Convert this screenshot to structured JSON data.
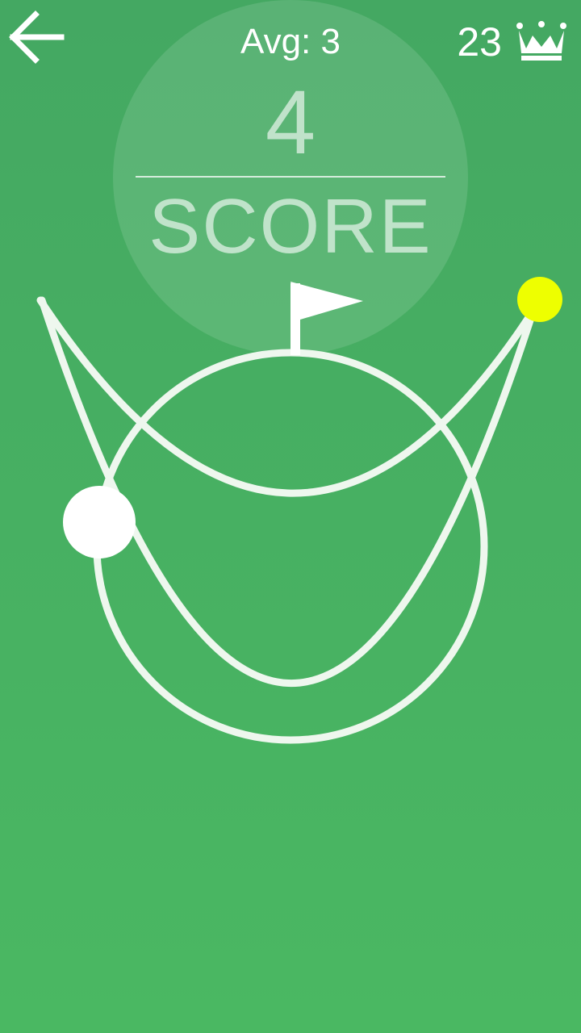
{
  "header": {
    "back_icon": "arrow-left-icon",
    "average_text": "Avg: 3",
    "best_score": "23",
    "best_icon": "crown-icon"
  },
  "score": {
    "value": "4",
    "label": "SCORE"
  },
  "colors": {
    "background_top": "#44a862",
    "background_bottom": "#4ab862",
    "track": "#eef7ee",
    "player_ball": "#ffffff",
    "target_ball": "#eeff00",
    "flag": "#ffffff"
  }
}
